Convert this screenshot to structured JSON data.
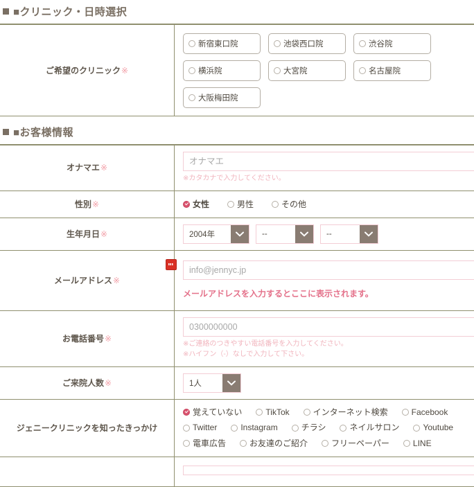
{
  "sections": [
    {
      "id": "clinic",
      "title": "■クリニック・日時選択"
    },
    {
      "id": "customer",
      "title": "■お客様情報"
    }
  ],
  "clinic_section": {
    "label": "ご希望のクリニック",
    "required_mark": "※",
    "options": [
      "新宿東口院",
      "池袋西口院",
      "渋谷院",
      "横浜院",
      "大宮院",
      "名古屋院",
      "大阪梅田院"
    ],
    "selected": null
  },
  "customer_section": {
    "name": {
      "label": "オナマエ",
      "required_mark": "※",
      "placeholder": "オナマエ",
      "value": "",
      "note": "※カタカナで入力してください。"
    },
    "gender": {
      "label": "性別",
      "required_mark": "※",
      "options": [
        "女性",
        "男性",
        "その他"
      ],
      "selected": "女性"
    },
    "birthday": {
      "label": "生年月日",
      "required_mark": "※",
      "year": "2004年",
      "month": "--",
      "day": "--"
    },
    "email": {
      "label": "メールアドレス",
      "required_mark": "※",
      "placeholder": "info@jennyc.jp",
      "value": "",
      "message": "メールアドレスを入力するとここに表示されます。",
      "badge_icon": "password-manager-icon"
    },
    "phone": {
      "label": "お電話番号",
      "required_mark": "※",
      "placeholder": "0300000000",
      "value": "",
      "notes": [
        "※ご連絡のつきやすい電話番号を入力してください。",
        "※ハイフン（-）なしで入力して下さい。"
      ]
    },
    "visitors": {
      "label": "ご来院人数",
      "required_mark": "※",
      "value": "1人"
    },
    "known_from": {
      "label": "ジェニークリニックを知ったきっかけ",
      "required_mark": "",
      "selected": "覚えていない",
      "rows": [
        [
          "覚えていない",
          "TikTok",
          "インターネット検索",
          "Facebook"
        ],
        [
          "Twitter",
          "Instagram",
          "チラシ",
          "ネイルサロン",
          "Youtube"
        ],
        [
          "電車広告",
          "お友達のご紹介",
          "フリーペーパー",
          "LINE"
        ]
      ]
    }
  },
  "colors": {
    "heading_text": "#7a6f63",
    "rule": "#8f8f6e",
    "input_border": "#f3cdd5",
    "accent_pink": "#e4718a",
    "radio_checked": "#d9546f",
    "select_arrow_bg": "#897c72",
    "note_pink": "#f1b4bd",
    "badge_red": "#d93025"
  }
}
